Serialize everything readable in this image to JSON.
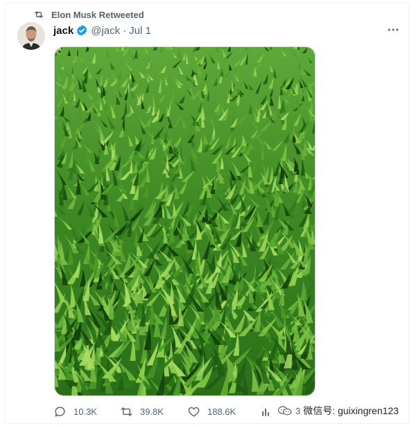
{
  "retweet_label": "Elon Musk Retweeted",
  "author": {
    "name": "jack",
    "handle": "@jack",
    "separator": "·",
    "date": "Jul 1",
    "verified": true
  },
  "media": {
    "description_icon": "grass-photo",
    "colors": {
      "base": "#2f7a1c",
      "highlight": "#8fd04e",
      "shadow": "#14400b"
    }
  },
  "actions": {
    "replies": "10.3K",
    "reposts": "39.8K",
    "likes": "188.6K",
    "views": "3"
  },
  "watermark": {
    "text": "微信号: guixingren123"
  },
  "colors": {
    "text_primary": "#0f1419",
    "text_secondary": "#536471",
    "verified_blue": "#1d9bf0",
    "border": "#cfd9de"
  }
}
